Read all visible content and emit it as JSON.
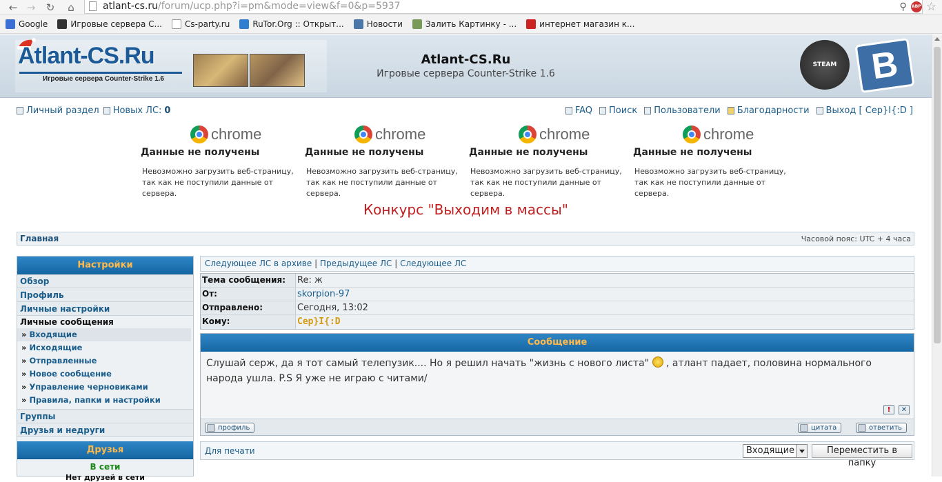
{
  "browser": {
    "url_host": "atlant-cs.ru",
    "url_path": "/forum/ucp.php?i=pm&mode=view&f=0&p=5937",
    "bookmarks": [
      {
        "label": "Google",
        "icon": "google-icon",
        "color": "#3b6fd4"
      },
      {
        "label": "Игровые сервера С...",
        "icon": "game-icon",
        "color": "#333333"
      },
      {
        "label": "Cs-party.ru",
        "icon": "page-icon",
        "color": "#ffffff"
      },
      {
        "label": "RuTor.Org :: Открыт...",
        "icon": "globe-icon",
        "color": "#2f7fd0"
      },
      {
        "label": "Новости",
        "icon": "vk-icon",
        "color": "#4a76a8"
      },
      {
        "label": "Залить Картинку - ...",
        "icon": "image-icon",
        "color": "#7a9a5a"
      },
      {
        "label": "интернет магазин к...",
        "icon": "shop-icon",
        "color": "#cc2222"
      }
    ]
  },
  "header": {
    "logo_text": "Atlant-CS.Ru",
    "logo_sub": "Игровые сервера Counter-Strike 1.6",
    "site_title": "Atlant-CS.Ru",
    "site_subtitle": "Игровые сервера Counter-Strike 1.6",
    "steam_label": "STEAM",
    "vk_letter": "B"
  },
  "topnav": {
    "personal": "Личный раздел",
    "new_pm_label": "Новых ЛС:",
    "new_pm_count": "0",
    "faq": "FAQ",
    "search": "Поиск",
    "users": "Пользователи",
    "thanks": "Благодарности",
    "logout": "Выход [ Сер}I{:D ]"
  },
  "chrome_errors": {
    "word": "chrome",
    "title": "Данные не получены",
    "body": "Невозможно загрузить веб-страницу, так как не поступили данные от сервера."
  },
  "contest": "Конкурс \"Выходим в массы\"",
  "breadcrumb": {
    "home": "Главная",
    "timezone": "Часовой пояс: UTC + 4 часа"
  },
  "sidebar": {
    "settings_title": "Настройки",
    "overview": "Обзор",
    "profile": "Профиль",
    "personal_settings": "Личные настройки",
    "pm_title": "Личные сообщения",
    "pm_items": [
      "Входящие",
      "Исходящие",
      "Отправленные",
      "Новое сообщение",
      "Управление черновиками",
      "Правила, папки и настройки"
    ],
    "groups": "Группы",
    "friends_foes": "Друзья и недруги",
    "friends_title": "Друзья",
    "online": "В сети",
    "no_friends": "Нет друзей в сети"
  },
  "pm": {
    "nav_archive": "Следующее ЛС в архиве",
    "nav_prev": "Предыдущее ЛС",
    "nav_next": "Следующее ЛС",
    "subject_label": "Тема сообщения:",
    "subject": "Re: ж",
    "from_label": "От:",
    "from": "skorpion-97",
    "sent_label": "Отправлено:",
    "sent": "Сегодня, 13:02",
    "to_label": "Кому:",
    "to": "Сер}I{:D",
    "message_title": "Сообщение",
    "message_part1": "Слушай серж, да я тот самый телепузик.... Но я решил начать \"жизнь с нового листа\"",
    "message_part2": ", атлант падает, половина нормального народа ушла. P.S Я уже не играю с читами/",
    "profile_btn": "профиль",
    "quote_btn": "цитата",
    "reply_btn": "ответить",
    "print": "Для печати",
    "folder_select": "Входящие",
    "move_btn": "Переместить в папку"
  }
}
